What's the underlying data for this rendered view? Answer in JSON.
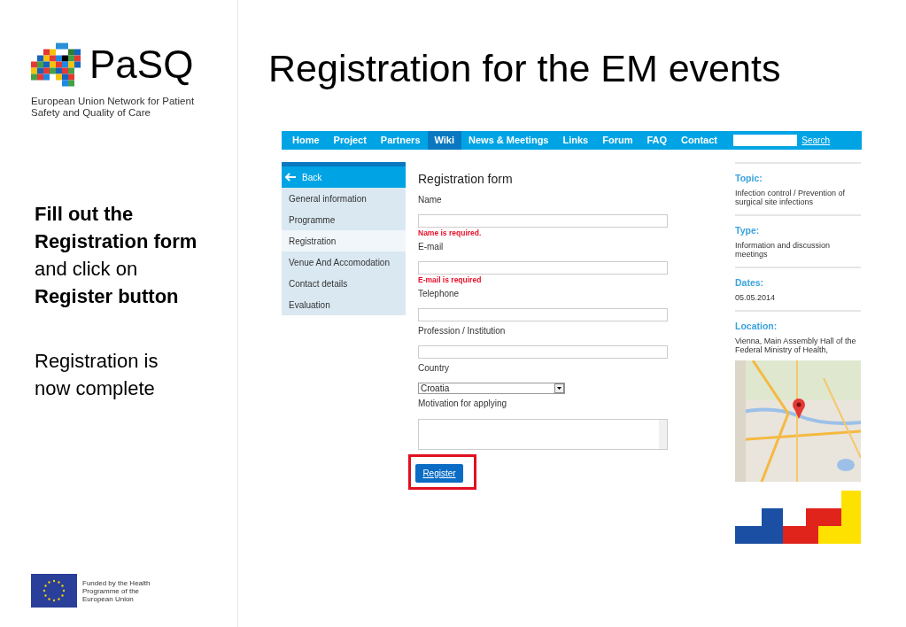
{
  "brand": {
    "name": "PaSQ",
    "tagline": "European Union Network for Patient Safety and Quality of Care"
  },
  "instructions": [
    "**Fill out the Registration form** and click on **Register button**",
    "Registration is now complete"
  ],
  "funding": "Funded by the Health Programme of the European Union",
  "title": "Registration for the EM events",
  "nav": {
    "items": [
      {
        "label": "Home",
        "selected": false
      },
      {
        "label": "Project",
        "selected": false
      },
      {
        "label": "Partners",
        "selected": false
      },
      {
        "label": "Wiki",
        "selected": true
      },
      {
        "label": "News & Meetings",
        "selected": false
      },
      {
        "label": "Links",
        "selected": false
      },
      {
        "label": "Forum",
        "selected": false
      },
      {
        "label": "FAQ",
        "selected": false
      },
      {
        "label": "Contact",
        "selected": false
      }
    ],
    "search_button": "Search"
  },
  "sidebar": {
    "back": "Back",
    "items": [
      {
        "label": "General information",
        "selected": false
      },
      {
        "label": "Programme",
        "selected": false
      },
      {
        "label": "Registration",
        "selected": true
      },
      {
        "label": "Venue And Accomodation",
        "selected": false
      },
      {
        "label": "Contact details",
        "selected": false
      },
      {
        "label": "Evaluation",
        "selected": false
      }
    ]
  },
  "form": {
    "title": "Registration form",
    "fields": [
      {
        "label": "Name",
        "kind": "text",
        "error": "Name is required."
      },
      {
        "label": "E-mail",
        "kind": "text",
        "error": "E-mail is required"
      },
      {
        "label": "Telephone",
        "kind": "text"
      },
      {
        "label": "Profession / Institution",
        "kind": "text"
      },
      {
        "label": "Country",
        "kind": "select",
        "value": "Croatia"
      },
      {
        "label": "Motivation for applying",
        "kind": "textarea"
      }
    ],
    "submit": "Register",
    "submit_highlighted": true
  },
  "details": [
    {
      "heading": "Topic:",
      "text": "Infection control / Prevention of surgical site infections"
    },
    {
      "heading": "Type:",
      "text": "Information and discussion meetings"
    },
    {
      "heading": "Dates:",
      "text": "05.05.2014"
    },
    {
      "heading": "Location:",
      "text": "Vienna, Main Assembly Hall of the Federal Ministry of Health,"
    }
  ]
}
